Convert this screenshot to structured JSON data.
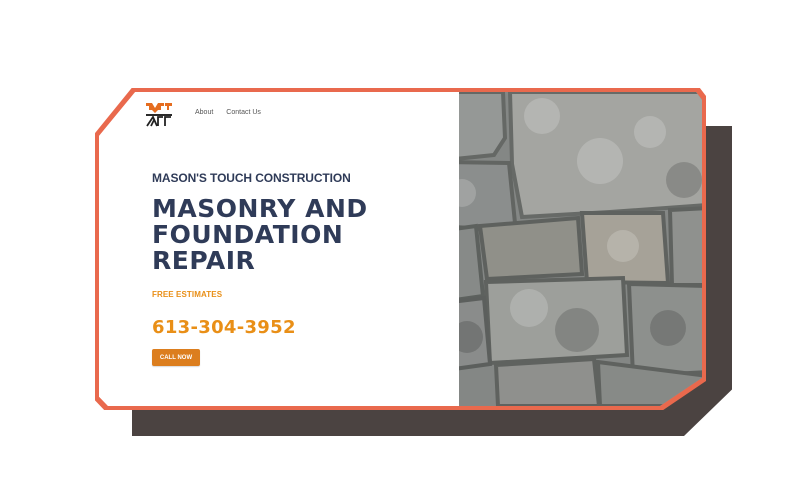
{
  "brand": {
    "logo_text": "MTC"
  },
  "nav": {
    "items": [
      {
        "label": "About"
      },
      {
        "label": "Contact Us"
      }
    ]
  },
  "hero": {
    "company_name": "MASON'S TOUCH CONSTRUCTION",
    "headline_lines": [
      "MASONRY AND",
      "FOUNDATION",
      "REPAIR"
    ],
    "subheading": "FREE ESTIMATES",
    "phone": "613-304-3952",
    "cta_label": "CALL NOW"
  },
  "colors": {
    "frame": "#e9694d",
    "shadow": "#4b4341",
    "navy": "#2f3b58",
    "accent": "#e98f17",
    "button": "#dc7e1e"
  }
}
